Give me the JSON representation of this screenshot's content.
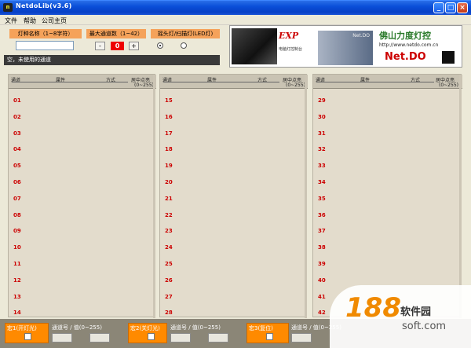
{
  "window": {
    "title": "NetdoLib(v3.6)",
    "app_icon_text": "m",
    "minimize_icon": "minimize-icon",
    "maximize_icon": "maximize-icon",
    "close_icon": "close-icon"
  },
  "menu": [
    "文件",
    "帮助",
    "公司主页"
  ],
  "top": {
    "lamp_name_label": "灯种名称（1~8字符）",
    "lamp_name_value": "",
    "max_channel_label": "最大通道数（1~42）",
    "minus_label": "-",
    "plus_label": "+",
    "max_channel_value": "0",
    "lamp_type_label": "摇头灯/扫描灯(LED灯)",
    "status_text": "空，未使用的通道"
  },
  "banner": {
    "exp": "EXP",
    "exp_sub": "电脑灯控制台",
    "dark_text": "Net.DO",
    "cn_name": "佛山力度灯控",
    "url": "http://www.netdo.com.cn",
    "brand": "Net.DO"
  },
  "columns": [
    {
      "header": {
        "channel": "通道",
        "attr": "属性",
        "mode": "方式",
        "center": "居中点亮",
        "range": "(0~255)"
      },
      "channels": [
        "01",
        "02",
        "03",
        "04",
        "05",
        "06",
        "07",
        "08",
        "09",
        "10",
        "11",
        "12",
        "13",
        "14"
      ]
    },
    {
      "header": {
        "channel": "通道",
        "attr": "属性",
        "mode": "方式",
        "center": "居中点亮",
        "range": "(0~255)"
      },
      "channels": [
        "15",
        "16",
        "17",
        "18",
        "19",
        "20",
        "21",
        "22",
        "23",
        "24",
        "25",
        "26",
        "27",
        "28"
      ]
    },
    {
      "header": {
        "channel": "通道",
        "attr": "属性",
        "mode": "方式",
        "center": "居中点亮",
        "range": "(0~255)"
      },
      "channels": [
        "29",
        "30",
        "31",
        "32",
        "33",
        "34",
        "35",
        "36",
        "37",
        "38",
        "39",
        "40",
        "41",
        "42"
      ]
    }
  ],
  "bottom": {
    "scene1": "宏1(开灯光)",
    "scene2": "宏2(关灯光)",
    "scene3": "宏3(复位)",
    "channel_value_label": "通道号 / 值(0~255)"
  },
  "watermark": {
    "number": "188",
    "cn": "软件园",
    "url": "soft.com"
  }
}
